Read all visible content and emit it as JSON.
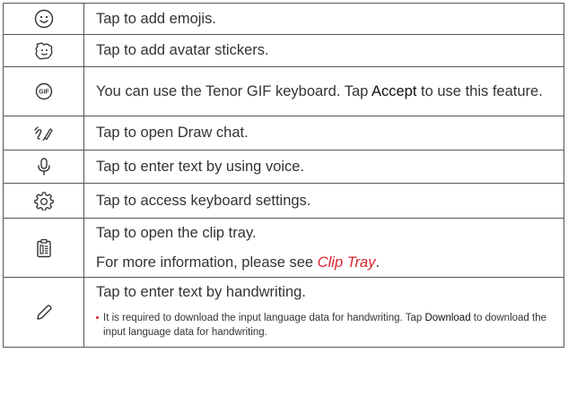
{
  "rows": [
    {
      "icon": "emoji-icon",
      "text": "Tap to add emojis."
    },
    {
      "icon": "avatar-sticker-icon",
      "text": "Tap to add avatar stickers."
    },
    {
      "icon": "gif-icon",
      "text_before": "You can use the Tenor GIF keyboard. Tap ",
      "bold": "Accept",
      "text_after": " to use this feature."
    },
    {
      "icon": "draw-chat-icon",
      "text": "Tap to open Draw chat."
    },
    {
      "icon": "microphone-icon",
      "text": "Tap to enter text by using voice."
    },
    {
      "icon": "gear-icon",
      "text": "Tap to access keyboard settings."
    },
    {
      "icon": "clipboard-icon",
      "text": "Tap to open the clip tray.",
      "text2_before": "For more information, please see ",
      "link": "Clip Tray",
      "text2_after": "."
    },
    {
      "icon": "pencil-icon",
      "text": "Tap to enter text by handwriting.",
      "bullet_before": "It is required to download the input language data for handwriting. Tap ",
      "bullet_bold": "Download",
      "bullet_after": " to download the input language data for handwriting."
    }
  ],
  "gif_icon_label": "GIF",
  "colors": {
    "accent": "#d9232e",
    "border": "#555555",
    "text": "#333333"
  }
}
